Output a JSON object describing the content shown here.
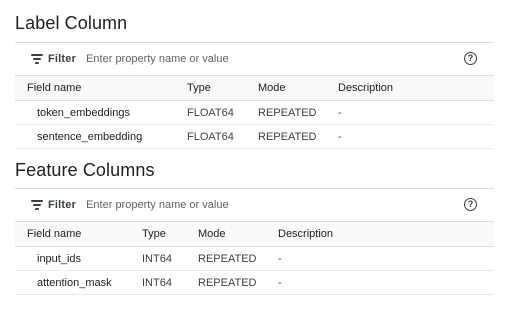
{
  "label_section": {
    "title": "Label Column",
    "filter_label": "Filter",
    "filter_placeholder": "Enter property name or value",
    "help_glyph": "?",
    "columns": [
      "Field name",
      "Type",
      "Mode",
      "Description"
    ],
    "rows": [
      {
        "name": "token_embeddings",
        "type": "FLOAT64",
        "mode": "REPEATED",
        "description": "-"
      },
      {
        "name": "sentence_embedding",
        "type": "FLOAT64",
        "mode": "REPEATED",
        "description": "-"
      }
    ]
  },
  "feature_section": {
    "title": "Feature Columns",
    "filter_label": "Filter",
    "filter_placeholder": "Enter property name or value",
    "help_glyph": "?",
    "columns": [
      "Field name",
      "Type",
      "Mode",
      "Description"
    ],
    "rows": [
      {
        "name": "input_ids",
        "type": "INT64",
        "mode": "REPEATED",
        "description": "-"
      },
      {
        "name": "attention_mask",
        "type": "INT64",
        "mode": "REPEATED",
        "description": "-"
      }
    ]
  },
  "icons": {
    "filter": "filter-icon",
    "help": "help-circle-icon"
  }
}
